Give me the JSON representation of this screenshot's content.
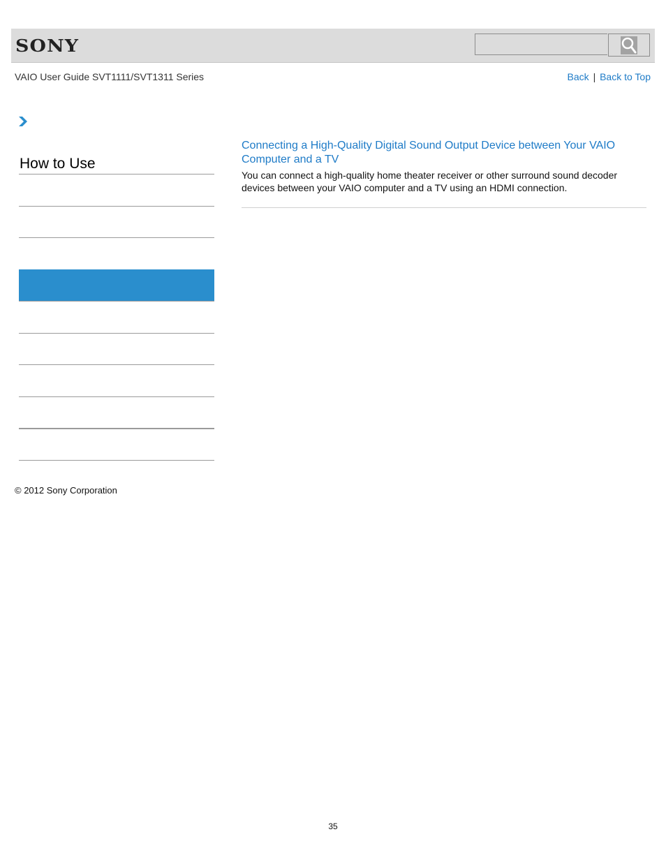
{
  "header": {
    "logo": "SONY",
    "search": {
      "placeholder": "",
      "value": "",
      "button_icon": "search-icon"
    }
  },
  "guide_title": "VAIO User Guide SVT1111/SVT1311 Series",
  "top_links": {
    "back": "Back",
    "separator": "|",
    "back_to_top": "Back to Top"
  },
  "breadcrumb": {
    "icon": "chevron-right-icon"
  },
  "sidebar": {
    "title": "How to Use",
    "items": [
      {
        "label": "",
        "active": false
      },
      {
        "label": "",
        "active": false
      },
      {
        "label": "",
        "active": true
      },
      {
        "label": "",
        "active": false
      },
      {
        "label": "",
        "active": false
      },
      {
        "label": "",
        "active": false
      },
      {
        "label": "",
        "active": false
      },
      {
        "label": "",
        "active": false
      }
    ],
    "active_color": "#2a8ecd"
  },
  "content": {
    "article": {
      "title": "Connecting a High-Quality Digital Sound Output Device between Your VAIO Computer and a TV",
      "description": "You can connect a high-quality home theater receiver or other surround sound decoder devices between your VAIO computer and a TV using an HDMI connection."
    }
  },
  "footer": {
    "copyright": "© 2012 Sony Corporation",
    "page_number": "35"
  },
  "colors": {
    "link": "#1e7bc7",
    "header_bg": "#dcdcdc"
  }
}
